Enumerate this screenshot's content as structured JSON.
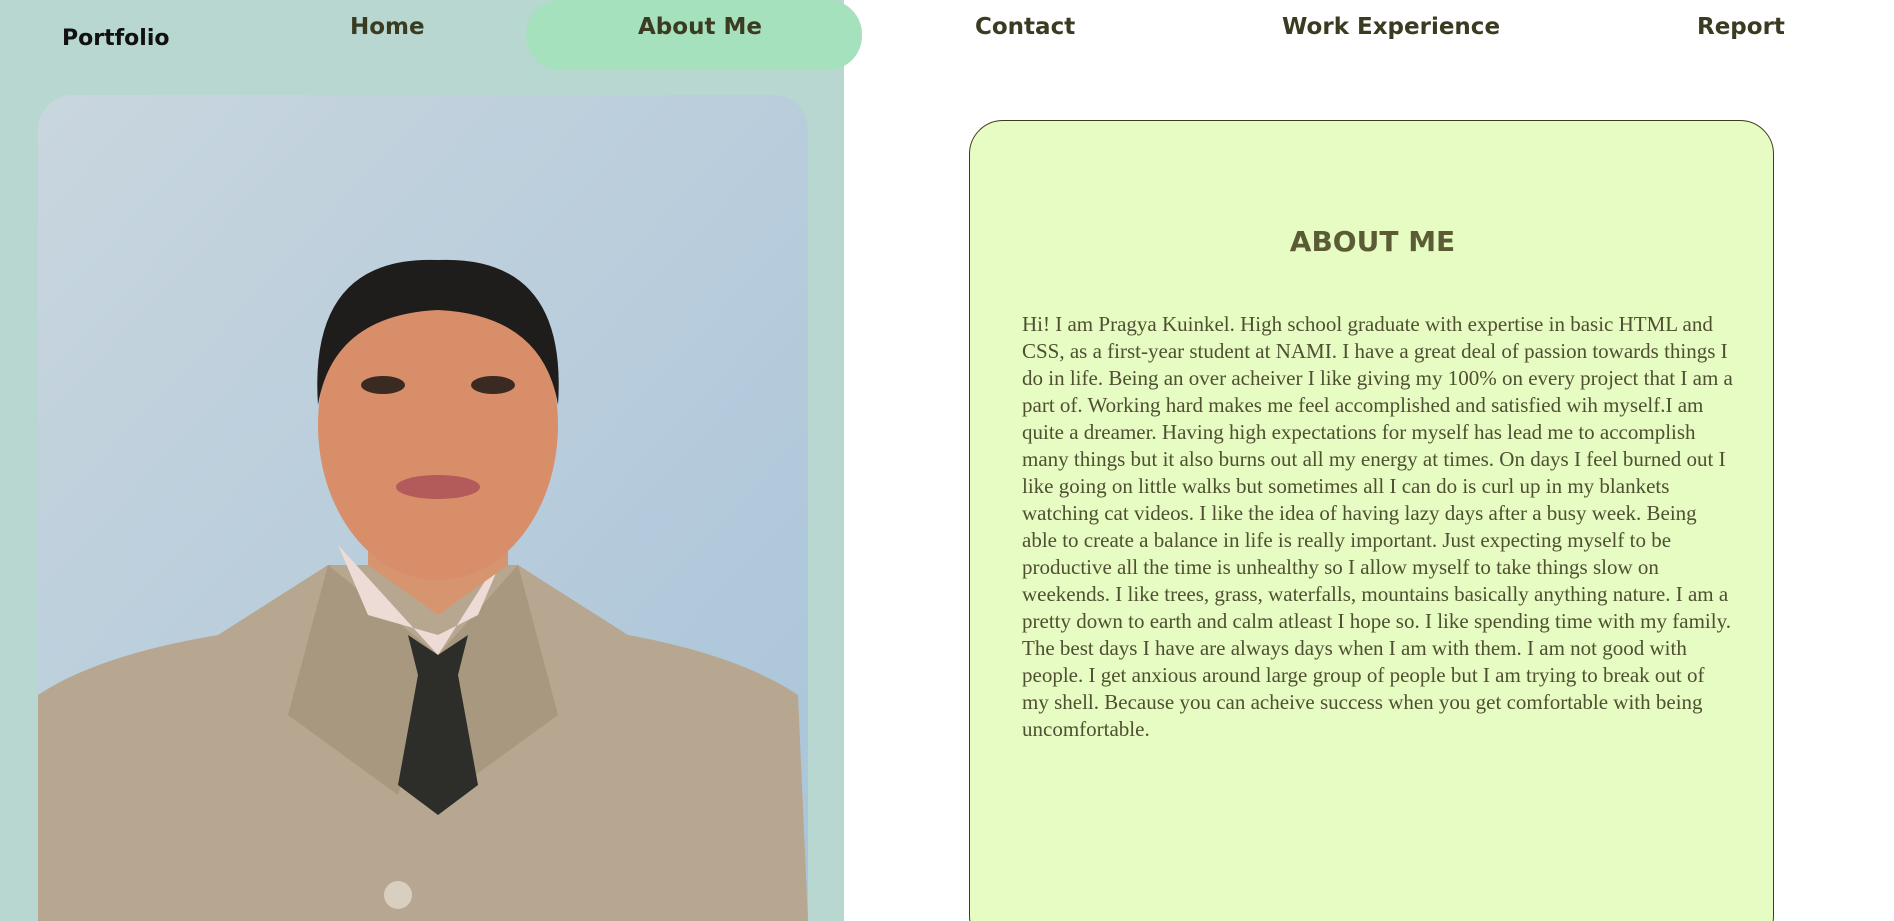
{
  "nav": {
    "brand": "Portfolio",
    "items": [
      {
        "label": "Home",
        "active": false
      },
      {
        "label": "About Me",
        "active": true
      },
      {
        "label": "Contact",
        "active": false
      },
      {
        "label": "Work Experience",
        "active": false
      },
      {
        "label": "Report",
        "active": false
      }
    ]
  },
  "about": {
    "heading": "ABOUT ME",
    "body": "Hi! I am Pragya Kuinkel. High school graduate with expertise in basic HTML and CSS, as a first-year student at NAMI. I have a great deal of passion towards things I do in life. Being an over acheiver I like giving my 100% on every project that I am a part of. Working hard makes me feel accomplished and satisfied wih myself.I am quite a dreamer. Having high expectations for myself has lead me to accomplish many things but it also burns out all my energy at times. On days I feel burned out I like going on little walks but sometimes all I can do is curl up in my blankets watching cat videos. I like the idea of having lazy days after a busy week. Being able to create a balance in life is really important. Just expecting myself to be productive all the time is unhealthy so I allow myself to take things slow on weekends. I like trees, grass, waterfalls, mountains basically anything nature. I am a pretty down to earth and calm atleast I hope so. I like spending time with my family. The best days I have are always days when I am with them. I am not good with people. I get anxious around large group of people but I am trying to break out of my shell. Because you can acheive success when you get comfortable with being uncomfortable."
  },
  "colors": {
    "left_panel": "#b7d7d0",
    "active_pill": "#a6e1bd",
    "card_bg": "#e6fcc2",
    "text_dark": "#3b3b22"
  }
}
